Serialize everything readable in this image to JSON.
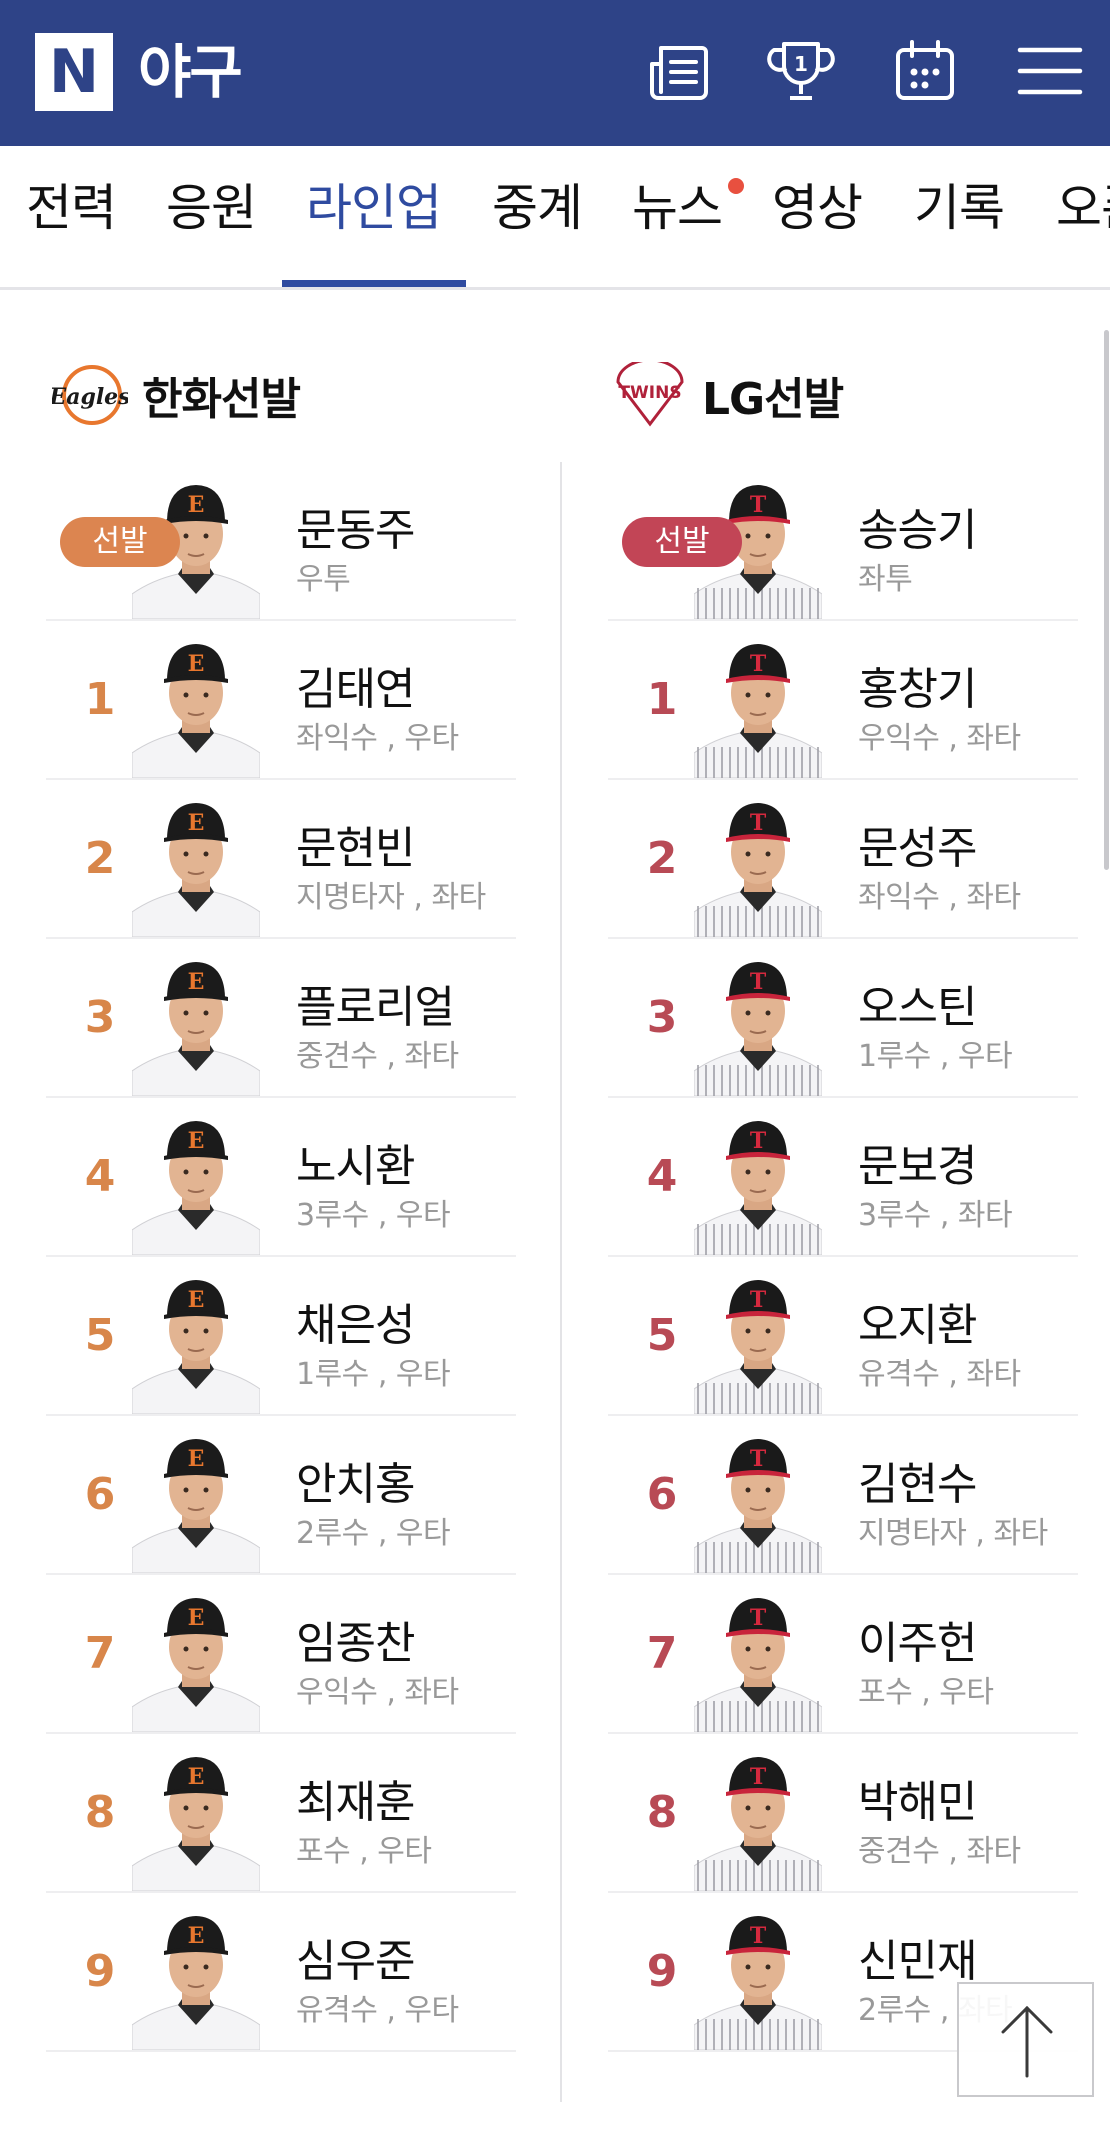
{
  "header": {
    "logo_letter": "N",
    "title": "야구",
    "icons": [
      "news-icon",
      "trophy-icon",
      "calendar-icon",
      "menu-icon"
    ],
    "trophy_number": "1",
    "color": "#2e4387"
  },
  "tabs": [
    {
      "label": "전력"
    },
    {
      "label": "응원"
    },
    {
      "label": "라인업",
      "active": true
    },
    {
      "label": "중계"
    },
    {
      "label": "뉴스",
      "new": true
    },
    {
      "label": "영상"
    },
    {
      "label": "기록"
    },
    {
      "label": "오픈"
    }
  ],
  "teams": {
    "left": {
      "name": "한화선발",
      "logo_text": "Eagles",
      "accent": "#dc8550",
      "players": [
        {
          "order": "선발",
          "name": "문동주",
          "position": "우투"
        },
        {
          "order": "1",
          "name": "김태연",
          "position": "좌익수 , 우타"
        },
        {
          "order": "2",
          "name": "문현빈",
          "position": "지명타자 , 좌타"
        },
        {
          "order": "3",
          "name": "플로리얼",
          "position": "중견수 , 좌타"
        },
        {
          "order": "4",
          "name": "노시환",
          "position": "3루수 , 우타"
        },
        {
          "order": "5",
          "name": "채은성",
          "position": "1루수 , 우타"
        },
        {
          "order": "6",
          "name": "안치홍",
          "position": "2루수 , 우타"
        },
        {
          "order": "7",
          "name": "임종찬",
          "position": "우익수 , 좌타"
        },
        {
          "order": "8",
          "name": "최재훈",
          "position": "포수 , 우타"
        },
        {
          "order": "9",
          "name": "심우준",
          "position": "유격수 , 우타"
        }
      ]
    },
    "right": {
      "name": "LG선발",
      "logo_text": "TWINS",
      "accent": "#c24556",
      "players": [
        {
          "order": "선발",
          "name": "송승기",
          "position": "좌투"
        },
        {
          "order": "1",
          "name": "홍창기",
          "position": "우익수 , 좌타"
        },
        {
          "order": "2",
          "name": "문성주",
          "position": "좌익수 , 좌타"
        },
        {
          "order": "3",
          "name": "오스틴",
          "position": "1루수 , 우타"
        },
        {
          "order": "4",
          "name": "문보경",
          "position": "3루수 , 좌타"
        },
        {
          "order": "5",
          "name": "오지환",
          "position": "유격수 , 좌타"
        },
        {
          "order": "6",
          "name": "김현수",
          "position": "지명타자 , 좌타"
        },
        {
          "order": "7",
          "name": "이주헌",
          "position": "포수 , 우타"
        },
        {
          "order": "8",
          "name": "박해민",
          "position": "중견수 , 좌타"
        },
        {
          "order": "9",
          "name": "신민재",
          "position": "2루수 , 좌타"
        }
      ]
    }
  },
  "scroll_top_icon": "arrow-up-icon"
}
